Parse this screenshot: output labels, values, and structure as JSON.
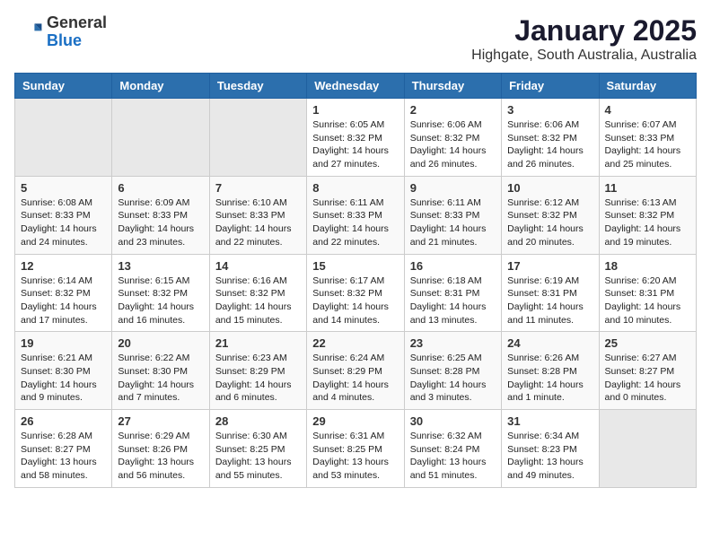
{
  "header": {
    "logo_general": "General",
    "logo_blue": "Blue",
    "title": "January 2025",
    "subtitle": "Highgate, South Australia, Australia"
  },
  "calendar": {
    "days_of_week": [
      "Sunday",
      "Monday",
      "Tuesday",
      "Wednesday",
      "Thursday",
      "Friday",
      "Saturday"
    ],
    "rows": [
      [
        {
          "day": "",
          "info": ""
        },
        {
          "day": "",
          "info": ""
        },
        {
          "day": "",
          "info": ""
        },
        {
          "day": "1",
          "info": "Sunrise: 6:05 AM\nSunset: 8:32 PM\nDaylight: 14 hours\nand 27 minutes."
        },
        {
          "day": "2",
          "info": "Sunrise: 6:06 AM\nSunset: 8:32 PM\nDaylight: 14 hours\nand 26 minutes."
        },
        {
          "day": "3",
          "info": "Sunrise: 6:06 AM\nSunset: 8:32 PM\nDaylight: 14 hours\nand 26 minutes."
        },
        {
          "day": "4",
          "info": "Sunrise: 6:07 AM\nSunset: 8:33 PM\nDaylight: 14 hours\nand 25 minutes."
        }
      ],
      [
        {
          "day": "5",
          "info": "Sunrise: 6:08 AM\nSunset: 8:33 PM\nDaylight: 14 hours\nand 24 minutes."
        },
        {
          "day": "6",
          "info": "Sunrise: 6:09 AM\nSunset: 8:33 PM\nDaylight: 14 hours\nand 23 minutes."
        },
        {
          "day": "7",
          "info": "Sunrise: 6:10 AM\nSunset: 8:33 PM\nDaylight: 14 hours\nand 22 minutes."
        },
        {
          "day": "8",
          "info": "Sunrise: 6:11 AM\nSunset: 8:33 PM\nDaylight: 14 hours\nand 22 minutes."
        },
        {
          "day": "9",
          "info": "Sunrise: 6:11 AM\nSunset: 8:33 PM\nDaylight: 14 hours\nand 21 minutes."
        },
        {
          "day": "10",
          "info": "Sunrise: 6:12 AM\nSunset: 8:32 PM\nDaylight: 14 hours\nand 20 minutes."
        },
        {
          "day": "11",
          "info": "Sunrise: 6:13 AM\nSunset: 8:32 PM\nDaylight: 14 hours\nand 19 minutes."
        }
      ],
      [
        {
          "day": "12",
          "info": "Sunrise: 6:14 AM\nSunset: 8:32 PM\nDaylight: 14 hours\nand 17 minutes."
        },
        {
          "day": "13",
          "info": "Sunrise: 6:15 AM\nSunset: 8:32 PM\nDaylight: 14 hours\nand 16 minutes."
        },
        {
          "day": "14",
          "info": "Sunrise: 6:16 AM\nSunset: 8:32 PM\nDaylight: 14 hours\nand 15 minutes."
        },
        {
          "day": "15",
          "info": "Sunrise: 6:17 AM\nSunset: 8:32 PM\nDaylight: 14 hours\nand 14 minutes."
        },
        {
          "day": "16",
          "info": "Sunrise: 6:18 AM\nSunset: 8:31 PM\nDaylight: 14 hours\nand 13 minutes."
        },
        {
          "day": "17",
          "info": "Sunrise: 6:19 AM\nSunset: 8:31 PM\nDaylight: 14 hours\nand 11 minutes."
        },
        {
          "day": "18",
          "info": "Sunrise: 6:20 AM\nSunset: 8:31 PM\nDaylight: 14 hours\nand 10 minutes."
        }
      ],
      [
        {
          "day": "19",
          "info": "Sunrise: 6:21 AM\nSunset: 8:30 PM\nDaylight: 14 hours\nand 9 minutes."
        },
        {
          "day": "20",
          "info": "Sunrise: 6:22 AM\nSunset: 8:30 PM\nDaylight: 14 hours\nand 7 minutes."
        },
        {
          "day": "21",
          "info": "Sunrise: 6:23 AM\nSunset: 8:29 PM\nDaylight: 14 hours\nand 6 minutes."
        },
        {
          "day": "22",
          "info": "Sunrise: 6:24 AM\nSunset: 8:29 PM\nDaylight: 14 hours\nand 4 minutes."
        },
        {
          "day": "23",
          "info": "Sunrise: 6:25 AM\nSunset: 8:28 PM\nDaylight: 14 hours\nand 3 minutes."
        },
        {
          "day": "24",
          "info": "Sunrise: 6:26 AM\nSunset: 8:28 PM\nDaylight: 14 hours\nand 1 minute."
        },
        {
          "day": "25",
          "info": "Sunrise: 6:27 AM\nSunset: 8:27 PM\nDaylight: 14 hours\nand 0 minutes."
        }
      ],
      [
        {
          "day": "26",
          "info": "Sunrise: 6:28 AM\nSunset: 8:27 PM\nDaylight: 13 hours\nand 58 minutes."
        },
        {
          "day": "27",
          "info": "Sunrise: 6:29 AM\nSunset: 8:26 PM\nDaylight: 13 hours\nand 56 minutes."
        },
        {
          "day": "28",
          "info": "Sunrise: 6:30 AM\nSunset: 8:25 PM\nDaylight: 13 hours\nand 55 minutes."
        },
        {
          "day": "29",
          "info": "Sunrise: 6:31 AM\nSunset: 8:25 PM\nDaylight: 13 hours\nand 53 minutes."
        },
        {
          "day": "30",
          "info": "Sunrise: 6:32 AM\nSunset: 8:24 PM\nDaylight: 13 hours\nand 51 minutes."
        },
        {
          "day": "31",
          "info": "Sunrise: 6:34 AM\nSunset: 8:23 PM\nDaylight: 13 hours\nand 49 minutes."
        },
        {
          "day": "",
          "info": ""
        }
      ]
    ]
  }
}
